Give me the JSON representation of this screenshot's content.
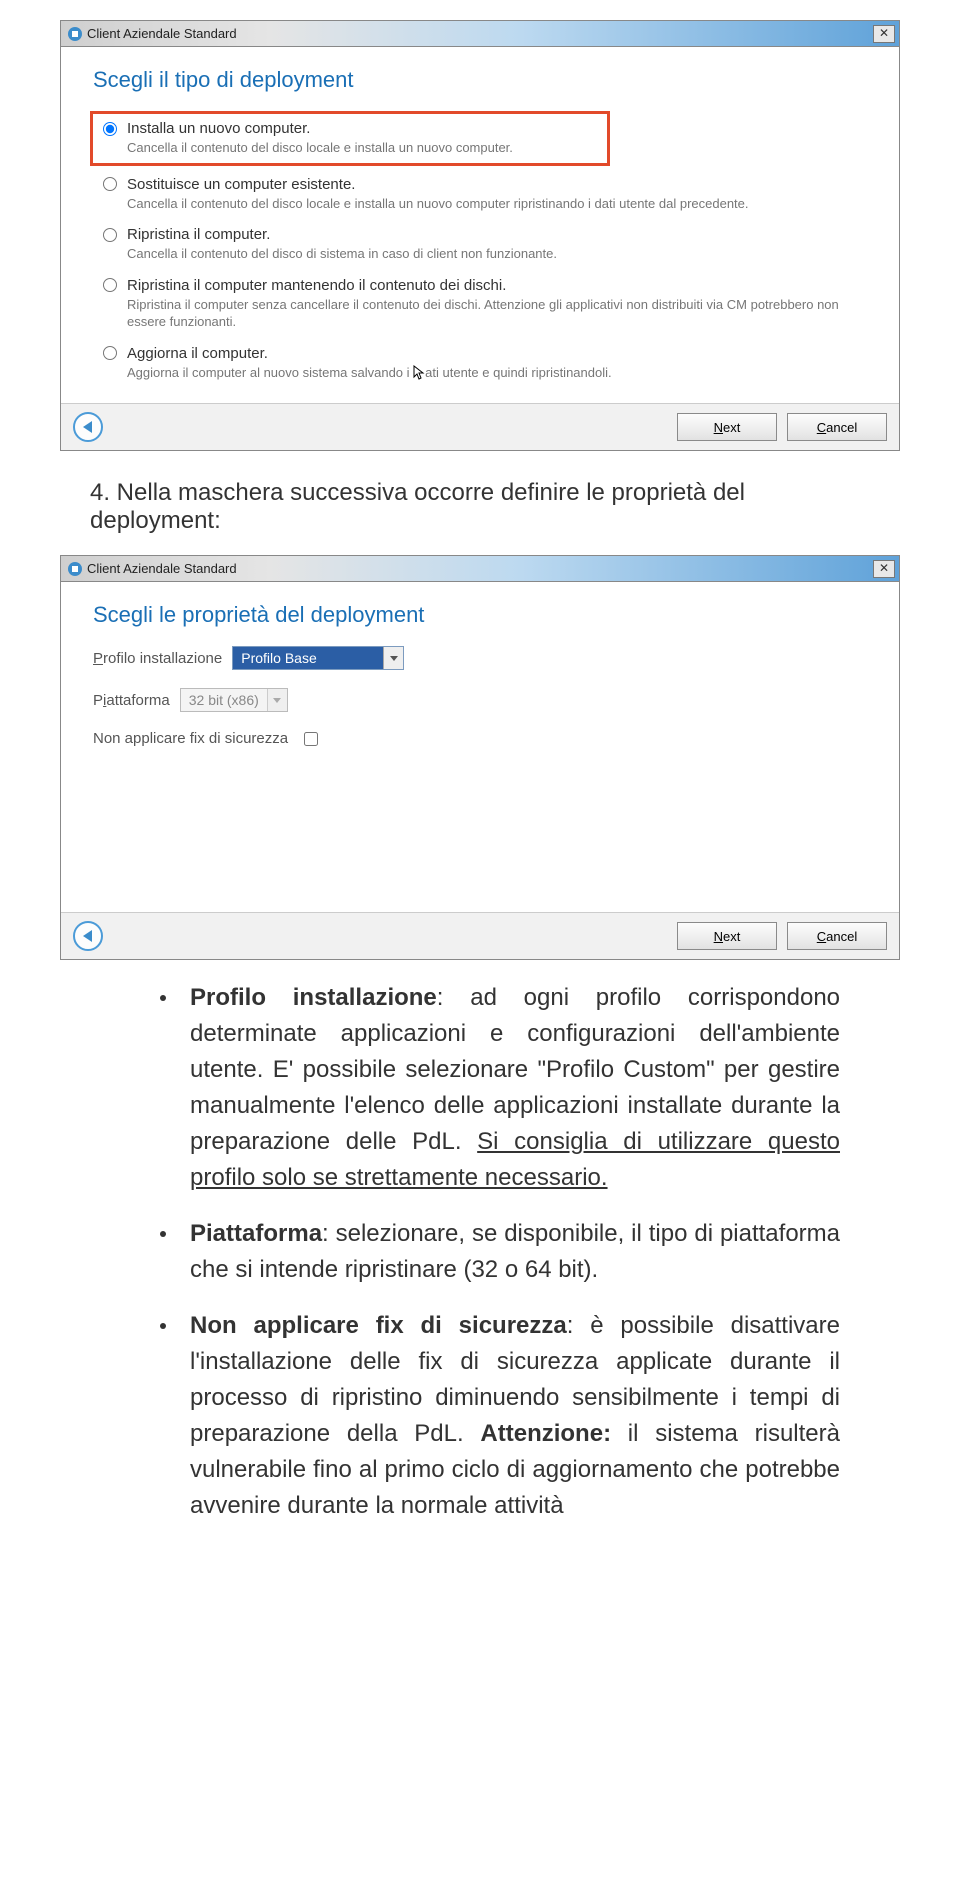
{
  "dialog1": {
    "title": "Client Aziendale Standard",
    "heading": "Scegli il tipo di deployment",
    "options": [
      {
        "label": "Installa un nuovo computer.",
        "desc": "Cancella il contenuto del disco locale e installa un nuovo computer.",
        "checked": true,
        "highlight": true
      },
      {
        "label": "Sostituisce un computer esistente.",
        "desc": "Cancella il contenuto del disco locale e installa un nuovo computer ripristinando i dati utente dal precedente."
      },
      {
        "label": "Ripristina il computer.",
        "desc": "Cancella il contenuto del disco di sistema in caso di client non funzionante."
      },
      {
        "label": "Ripristina il computer mantenendo il contenuto dei dischi.",
        "desc": "Ripristina il computer senza cancellare il contenuto dei dischi. Attenzione gli applicativi non distribuiti via CM potrebbero non essere funzionanti."
      },
      {
        "label": "Aggiorna il computer.",
        "desc_pre": "Aggiorna il computer al nuovo sistema salvando i ",
        "desc_post": "ati utente e quindi ripristinandoli."
      }
    ],
    "btn_next": "Next",
    "btn_cancel": "Cancel",
    "btn_next_hotkey": "N",
    "btn_cancel_hotkey": "C"
  },
  "step_text": "4. Nella maschera successiva occorre definire le proprietà del deployment:",
  "dialog2": {
    "title": "Client Aziendale Standard",
    "heading": "Scegli le proprietà del deployment",
    "profilo_label": "Profilo installazione",
    "profilo_value": "Profilo Base",
    "piattaforma_label": "Piattaforma",
    "piattaforma_value": "32 bit (x86)",
    "fix_label": "Non applicare fix di sicurezza",
    "btn_next": "Next",
    "btn_cancel": "Cancel",
    "btn_next_hotkey": "N",
    "btn_cancel_hotkey": "C"
  },
  "bullets": [
    {
      "lead": "Profilo installazione",
      "body_before": ": ad ogni profilo corrispondono determinate applicazioni e configurazioni dell'ambiente utente. E' possibile selezionare \"Profilo Custom\" per gestire manualmente l'elenco delle applicazioni installate durante la preparazione delle PdL. ",
      "underline": "Si consiglia di utilizzare questo profilo solo se strettamente necessario.",
      "body_after": ""
    },
    {
      "lead": "Piattaforma",
      "body_before": ": selezionare, se disponibile, il tipo di piattaforma che si intende ripristinare (32 o 64 bit).",
      "underline": "",
      "body_after": ""
    },
    {
      "lead": "Non applicare fix di sicurezza",
      "body_before": ": è possibile disattivare l'installazione delle fix di sicurezza applicate durante il processo di ripristino diminuendo sensibilmente i tempi di preparazione della PdL. ",
      "attention_lead": "Attenzione:",
      "body_after": " il sistema risulterà vulnerabile fino al primo ciclo di aggiornamento che potrebbe avvenire durante la normale attività"
    }
  ]
}
